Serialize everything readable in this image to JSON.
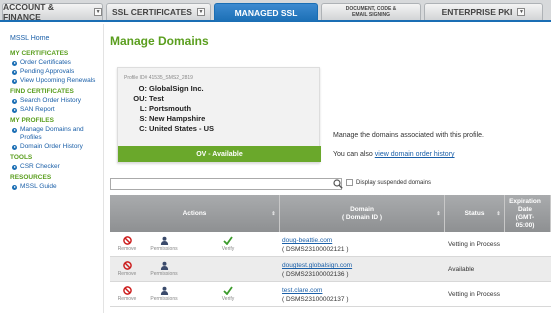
{
  "tabs": [
    {
      "label": "ACCOUNT & FINANCE",
      "dropdown": true
    },
    {
      "label": "SSL CERTIFICATES",
      "dropdown": true
    },
    {
      "label": "MANAGED SSL",
      "dropdown": false,
      "active": true
    },
    {
      "label": "DOCUMENT, CODE & EMAIL SIGNING",
      "dropdown": false
    },
    {
      "label": "ENTERPRISE PKI",
      "dropdown": true
    }
  ],
  "sidebar": {
    "home": "MSSL Home",
    "sections": [
      {
        "heading": "MY CERTIFICATES",
        "items": [
          "Order Certificates",
          "Pending Approvals",
          "View Upcoming Renewals"
        ]
      },
      {
        "heading": "FIND CERTIFICATES",
        "items": [
          "Search Order History",
          "SAN Report"
        ]
      },
      {
        "heading": "MY PROFILES",
        "items": [
          "Manage Domains and Profiles",
          "Domain Order History"
        ]
      },
      {
        "heading": "TOOLS",
        "items": [
          "CSR Checker"
        ]
      },
      {
        "heading": "RESOURCES",
        "items": [
          "MSSL Guide"
        ]
      }
    ]
  },
  "page": {
    "title": "Manage Domains"
  },
  "profile": {
    "id_text": "Profile ID# 41535_SMS2_2819",
    "fields": [
      {
        "k": "O:",
        "v": "GlobalSign Inc."
      },
      {
        "k": "OU:",
        "v": "Test"
      },
      {
        "k": "L:",
        "v": "Portsmouth"
      },
      {
        "k": "S:",
        "v": "New Hampshire"
      },
      {
        "k": "C:",
        "v": "United States - US"
      }
    ],
    "status": "OV - Available",
    "status_color": "#6aa82b"
  },
  "description": "Manage the domains associated with this profile.",
  "history": {
    "prefix": "You can also ",
    "link": "view domain order history"
  },
  "search": {
    "value": "",
    "icon": "magnifier-icon",
    "suspended_label": "Display suspended domains"
  },
  "table": {
    "headers": {
      "actions": "Actions",
      "domain": "Domain",
      "domain_id": "( Domain ID )",
      "status": "Status",
      "expiration": "Expiration Date (GMT-05:00)"
    },
    "action_labels": {
      "remove": "Remove",
      "permissions": "Permissions",
      "verify": "Verify"
    },
    "rows": [
      {
        "domain": "doug-beattie.com",
        "domain_id": "( DSMS23100002121 )",
        "status": "Vetting in Process",
        "verify": true
      },
      {
        "domain": "dougtest.globalsign.com",
        "domain_id": "( DSMS23100002136 )",
        "status": "Available",
        "verify": false
      },
      {
        "domain": "test.clare.com",
        "domain_id": "( DSMS23100002137 )",
        "status": "Vetting in Process",
        "verify": true
      }
    ]
  },
  "colors": {
    "accent_green": "#5a9e1e",
    "tab_blue": "#1a6eb4",
    "link_blue": "#1a5fa8",
    "remove_red": "#cc1b1b"
  }
}
